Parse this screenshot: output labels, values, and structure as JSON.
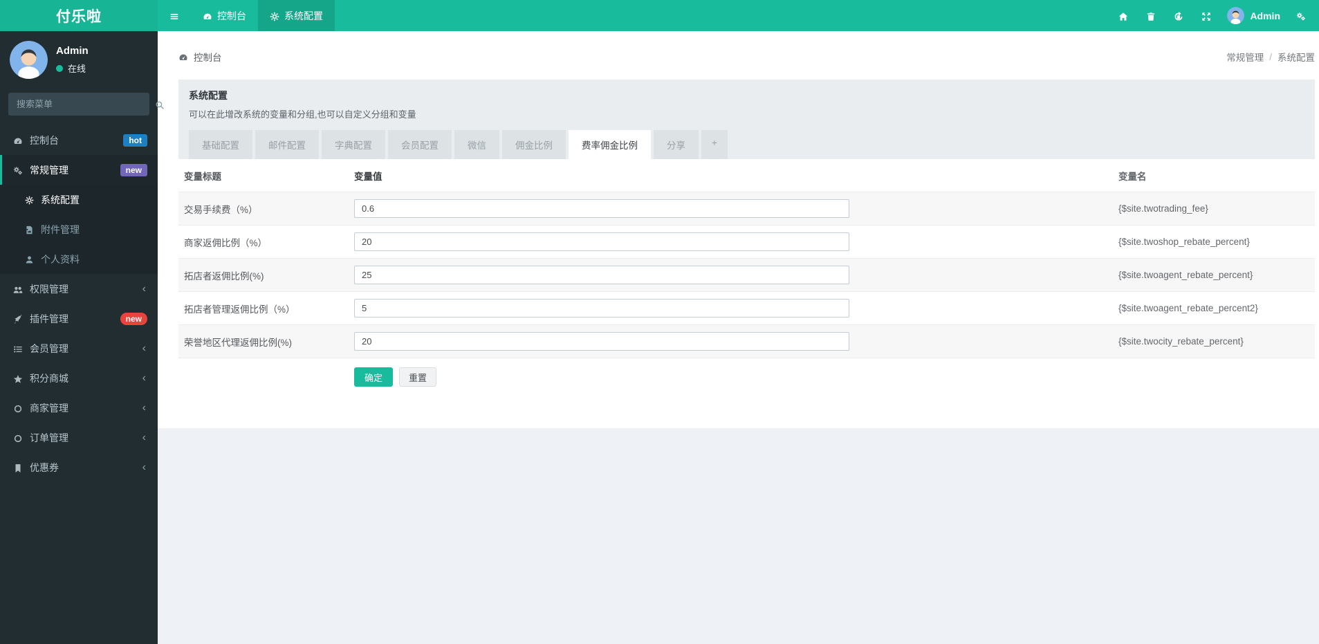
{
  "brand": {
    "logo": "付乐啦"
  },
  "topbar": {
    "nav": [
      {
        "label": "控制台",
        "icon": "dashboard-icon",
        "active": false
      },
      {
        "label": "系统配置",
        "icon": "gear-icon",
        "active": true
      }
    ],
    "icons": [
      "menu-icon",
      "home-icon",
      "trash-icon",
      "clear-cache-icon",
      "fullscreen-icon",
      "settings-gears-icon"
    ],
    "user": {
      "name": "Admin"
    }
  },
  "sidebar": {
    "user": {
      "name": "Admin",
      "status": "在线"
    },
    "search_placeholder": "搜索菜单",
    "items": [
      {
        "label": "控制台",
        "icon": "dashboard-icon",
        "badge": "hot"
      },
      {
        "label": "常规管理",
        "icon": "cogs-icon",
        "badge": "new",
        "children": [
          {
            "label": "系统配置",
            "icon": "gear-icon",
            "active": true
          },
          {
            "label": "附件管理",
            "icon": "file-image-icon"
          },
          {
            "label": "个人资料",
            "icon": "user-icon"
          }
        ]
      },
      {
        "label": "权限管理",
        "icon": "users-icon"
      },
      {
        "label": "插件管理",
        "icon": "rocket-icon",
        "badge": "new"
      },
      {
        "label": "会员管理",
        "icon": "list-icon"
      },
      {
        "label": "积分商城",
        "icon": "star-icon"
      },
      {
        "label": "商家管理",
        "icon": "circle-icon"
      },
      {
        "label": "订单管理",
        "icon": "circle-icon"
      },
      {
        "label": "优惠券",
        "icon": "bookmark-icon"
      }
    ]
  },
  "breadcrumb": {
    "left": "控制台",
    "separator": "/",
    "right": [
      "常规管理",
      "系统配置"
    ]
  },
  "panel": {
    "title": "系统配置",
    "description": "可以在此增改系统的变量和分组,也可以自定义分组和变量",
    "tabs": [
      {
        "label": "基础配置"
      },
      {
        "label": "邮件配置"
      },
      {
        "label": "字典配置"
      },
      {
        "label": "会员配置"
      },
      {
        "label": "微信"
      },
      {
        "label": "佣金比例"
      },
      {
        "label": "费率佣金比例",
        "active": true
      },
      {
        "label": "分享"
      },
      {
        "label": "+"
      }
    ],
    "table": {
      "headers": [
        "变量标题",
        "变量值",
        "变量名"
      ],
      "rows": [
        {
          "title": "交易手续费（%）",
          "value": "0.6",
          "name": "{$site.twotrading_fee}"
        },
        {
          "title": "商家返佣比例（%）",
          "value": "20",
          "name": "{$site.twoshop_rebate_percent}"
        },
        {
          "title": "拓店者返佣比例(%)",
          "value": "25",
          "name": "{$site.twoagent_rebate_percent}"
        },
        {
          "title": "拓店者管理返佣比例（%）",
          "value": "5",
          "name": "{$site.twoagent_rebate_percent2}"
        },
        {
          "title": "荣誉地区代理返佣比例(%)",
          "value": "20",
          "name": "{$site.twocity_rebate_percent}"
        }
      ],
      "buttons": {
        "ok": "确定",
        "reset": "重置"
      }
    }
  },
  "colors": {
    "accent_teal": "#18bc9c",
    "topbar_active": "#14a689",
    "sidebar_bg": "#222d32",
    "badge_hot_blue": "#1d80c3",
    "badge_new_purple": "#7266ba",
    "badge_new_red": "#e7453c",
    "panel_heading_bg": "#e9edf0",
    "page_bg": "#eef1f5",
    "row_stripe": "#f7f7f7"
  }
}
